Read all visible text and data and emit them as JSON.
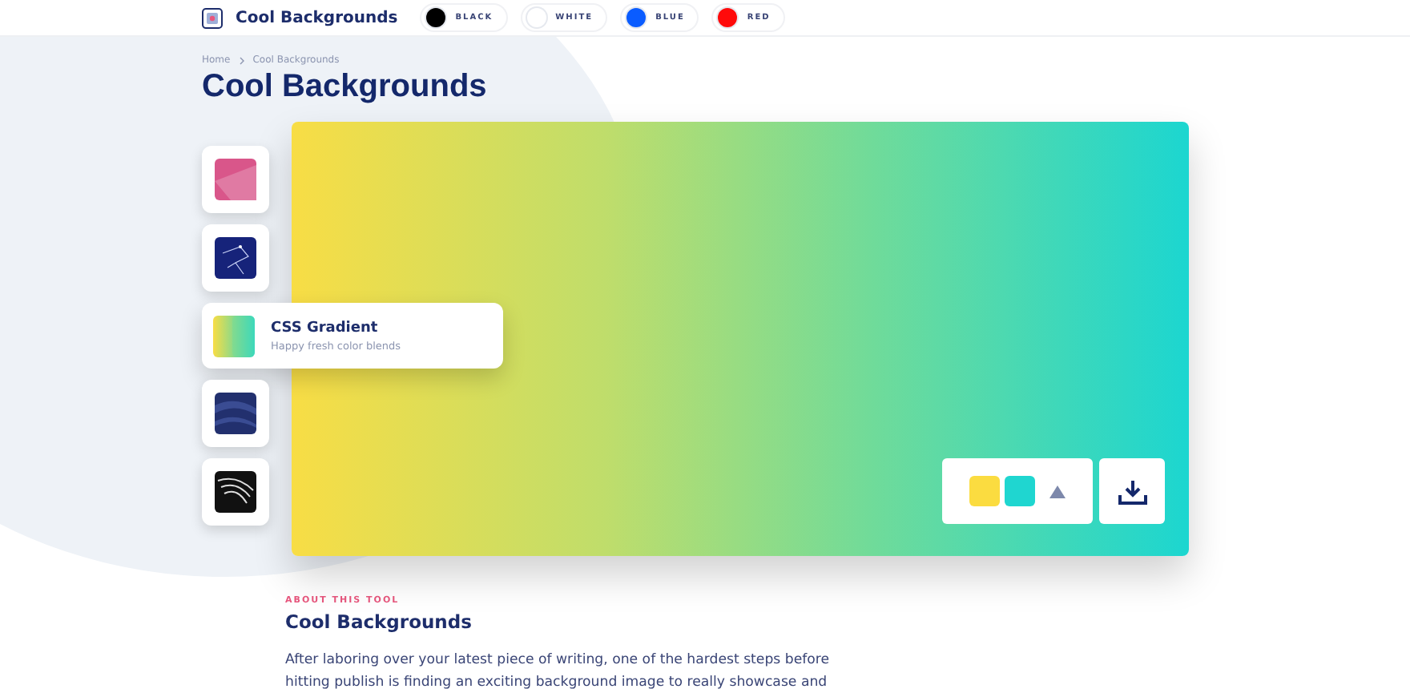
{
  "header": {
    "brand": "Cool Backgrounds",
    "themes": [
      {
        "label": "BLACK",
        "color": "#000000"
      },
      {
        "label": "WHITE",
        "color": "#ffffff"
      },
      {
        "label": "BLUE",
        "color": "#0a5cff"
      },
      {
        "label": "RED",
        "color": "#ff0a0a"
      }
    ]
  },
  "breadcrumb": [
    "Home",
    "Cool Backgrounds"
  ],
  "title": "Cool Backgrounds",
  "generators": [
    {
      "kind": "pink",
      "selected": false
    },
    {
      "kind": "constellation",
      "selected": false
    },
    {
      "kind": "gradient",
      "selected": true,
      "title": "CSS Gradient",
      "subtitle": "Happy fresh color blends"
    },
    {
      "kind": "waves",
      "selected": false
    },
    {
      "kind": "zebra",
      "selected": false
    }
  ],
  "swatches": [
    {
      "color": "#fbdc40"
    },
    {
      "color": "#1fd6d0"
    }
  ],
  "about": {
    "eyebrow": "ABOUT THIS TOOL",
    "heading": "Cool Backgrounds",
    "paragraph": "After laboring over your latest piece of writing, one of the hardest steps before hitting publish is finding an exciting background image to really showcase and"
  }
}
